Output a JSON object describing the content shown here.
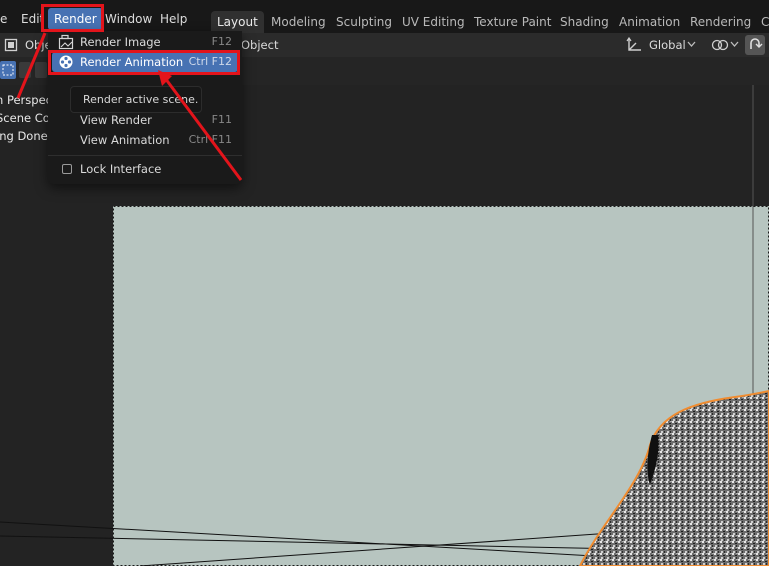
{
  "menubar": {
    "file_partial": "e",
    "edit": "Edit",
    "render": "Render",
    "window": "Window",
    "help": "Help"
  },
  "workspaces": {
    "tabs": [
      "Layout",
      "Modeling",
      "Sculpting",
      "UV Editing",
      "Texture Paint",
      "Shading",
      "Animation",
      "Rendering",
      "Co"
    ],
    "active": "Layout"
  },
  "header": {
    "mode_partial": "Obje",
    "object_menu": "Object",
    "transform_orientation": "Global"
  },
  "viewport_overlay": {
    "line1": "n Perspect",
    "line2": "Scene Colle",
    "line3": "ing Done"
  },
  "render_menu": {
    "items": [
      {
        "label": "Render Image",
        "shortcut": "F12",
        "icon": "render-image-icon"
      },
      {
        "label": "Render Animation",
        "shortcut": "Ctrl F12",
        "icon": "render-animation-icon"
      },
      {
        "label": "View Render",
        "shortcut": "F11"
      },
      {
        "label": "View Animation",
        "shortcut": "Ctrl F11"
      },
      {
        "label": "Lock Interface",
        "checkbox": false
      }
    ],
    "tooltip": "Render active scene."
  },
  "colors": {
    "accent": "#4772b3",
    "annotation_red": "#e3141b",
    "selection_outline": "#f08c30",
    "camera_bg": "#b9c7c2"
  }
}
